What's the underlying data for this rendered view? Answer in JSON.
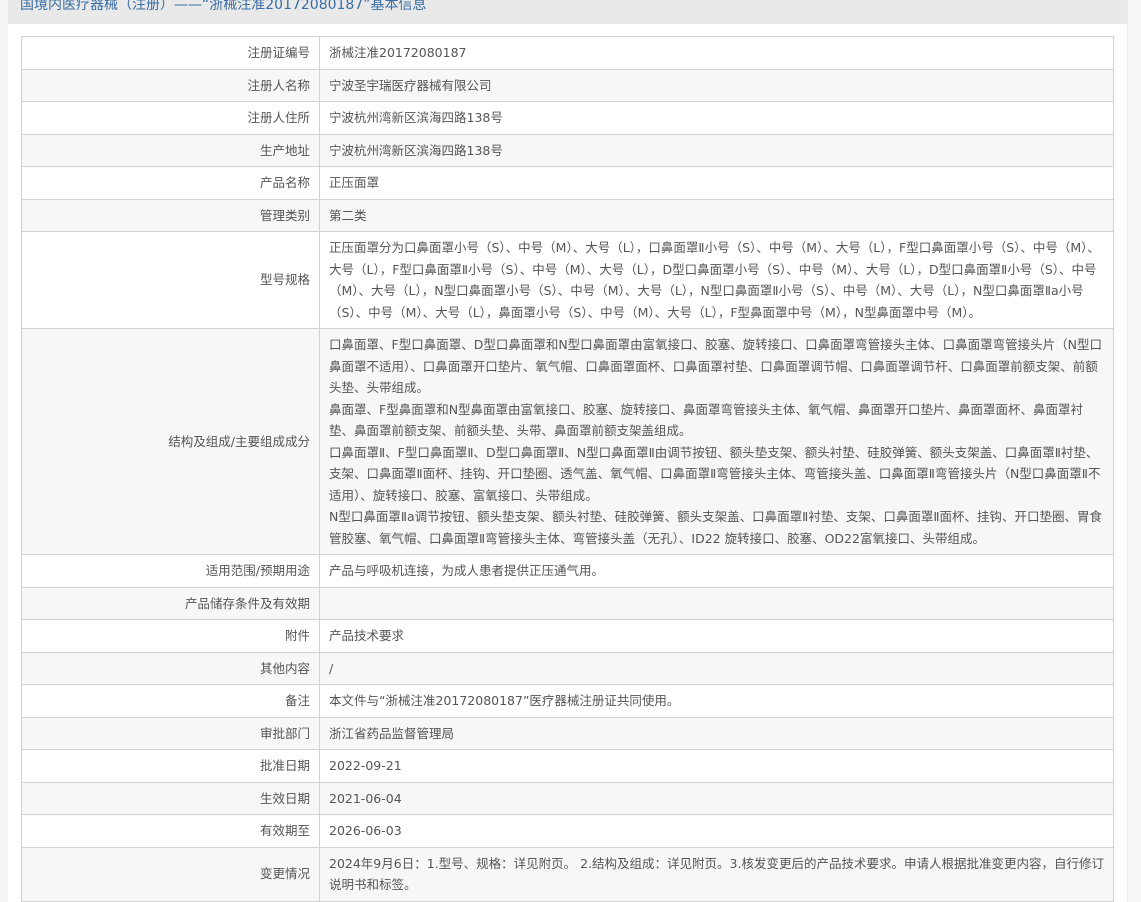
{
  "header": {
    "title": "国境内医疗器械（注册）——“浙械注准20172080187”基本信息"
  },
  "rows": [
    {
      "label": "注册证编号",
      "value": "浙械注准20172080187"
    },
    {
      "label": "注册人名称",
      "value": "宁波圣宇瑞医疗器械有限公司"
    },
    {
      "label": "注册人住所",
      "value": "宁波杭州湾新区滨海四路138号"
    },
    {
      "label": "生产地址",
      "value": "宁波杭州湾新区滨海四路138号"
    },
    {
      "label": "产品名称",
      "value": "正压面罩"
    },
    {
      "label": "管理类别",
      "value": "第二类"
    },
    {
      "label": "型号规格",
      "value": "正压面罩分为口鼻面罩小号（S）、中号（M）、大号（L），口鼻面罩Ⅱ小号（S）、中号（M）、大号（L），F型口鼻面罩小号（S）、中号（M）、大号（L），F型口鼻面罩Ⅱ小号（S）、中号（M）、大号（L），D型口鼻面罩小号（S）、中号（M）、大号（L），D型口鼻面罩Ⅱ小号（S）、中号（M）、大号（L），N型口鼻面罩小号（S）、中号（M）、大号（L），N型口鼻面罩Ⅱ小号（S）、中号（M）、大号（L），N型口鼻面罩Ⅱa小号（S）、中号（M）、大号（L），鼻面罩小号（S）、中号（M）、大号（L），F型鼻面罩中号（M），N型鼻面罩中号（M）。"
    },
    {
      "label": "结构及组成/主要组成成分",
      "value": "口鼻面罩、F型口鼻面罩、D型口鼻面罩和N型口鼻面罩由富氧接口、胶塞、旋转接口、口鼻面罩弯管接头主体、口鼻面罩弯管接头片（N型口鼻面罩不适用）、口鼻面罩开口垫片、氧气帽、口鼻面罩面杯、口鼻面罩衬垫、口鼻面罩调节帽、口鼻面罩调节杆、口鼻面罩前额支架、前额头垫、头带组成。\n鼻面罩、F型鼻面罩和N型鼻面罩由富氧接口、胶塞、旋转接口、鼻面罩弯管接头主体、氧气帽、鼻面罩开口垫片、鼻面罩面杯、鼻面罩衬垫、鼻面罩前额支架、前额头垫、头带、鼻面罩前额支架盖组成。\n口鼻面罩Ⅱ、F型口鼻面罩Ⅱ、D型口鼻面罩Ⅱ、N型口鼻面罩Ⅱ由调节按钮、额头垫支架、额头衬垫、硅胶弹簧、额头支架盖、口鼻面罩Ⅱ衬垫、支架、口鼻面罩Ⅱ面杯、挂钩、开口垫圈、透气盖、氧气帽、口鼻面罩Ⅱ弯管接头主体、弯管接头盖、口鼻面罩Ⅱ弯管接头片（N型口鼻面罩Ⅱ不适用）、旋转接口、胶塞、富氧接口、头带组成。\nN型口鼻面罩Ⅱa调节按钮、额头垫支架、额头衬垫、硅胶弹簧、额头支架盖、口鼻面罩Ⅱ衬垫、支架、口鼻面罩Ⅱ面杯、挂钩、开口垫圈、胃食管胶塞、氧气帽、口鼻面罩Ⅱ弯管接头主体、弯管接头盖（无孔）、ID22 旋转接口、胶塞、OD22富氧接口、头带组成。"
    },
    {
      "label": "适用范围/预期用途",
      "value": "产品与呼吸机连接，为成人患者提供正压通气用。"
    },
    {
      "label": "产品储存条件及有效期",
      "value": ""
    },
    {
      "label": "附件",
      "value": "产品技术要求"
    },
    {
      "label": "其他内容",
      "value": "/"
    },
    {
      "label": "备注",
      "value": "本文件与“浙械注准20172080187”医疗器械注册证共同使用。"
    },
    {
      "label": "审批部门",
      "value": "浙江省药品监督管理局"
    },
    {
      "label": "批准日期",
      "value": "2022-09-21"
    },
    {
      "label": "生效日期",
      "value": "2021-06-04"
    },
    {
      "label": "有效期至",
      "value": "2026-06-03"
    },
    {
      "label": "变更情况",
      "value": "2024年9月6日：1.型号、规格：详见附页。 2.结构及组成：详见附页。3.核发变更后的产品技术要求。申请人根据批准变更内容，自行修订说明书和标签。"
    }
  ]
}
